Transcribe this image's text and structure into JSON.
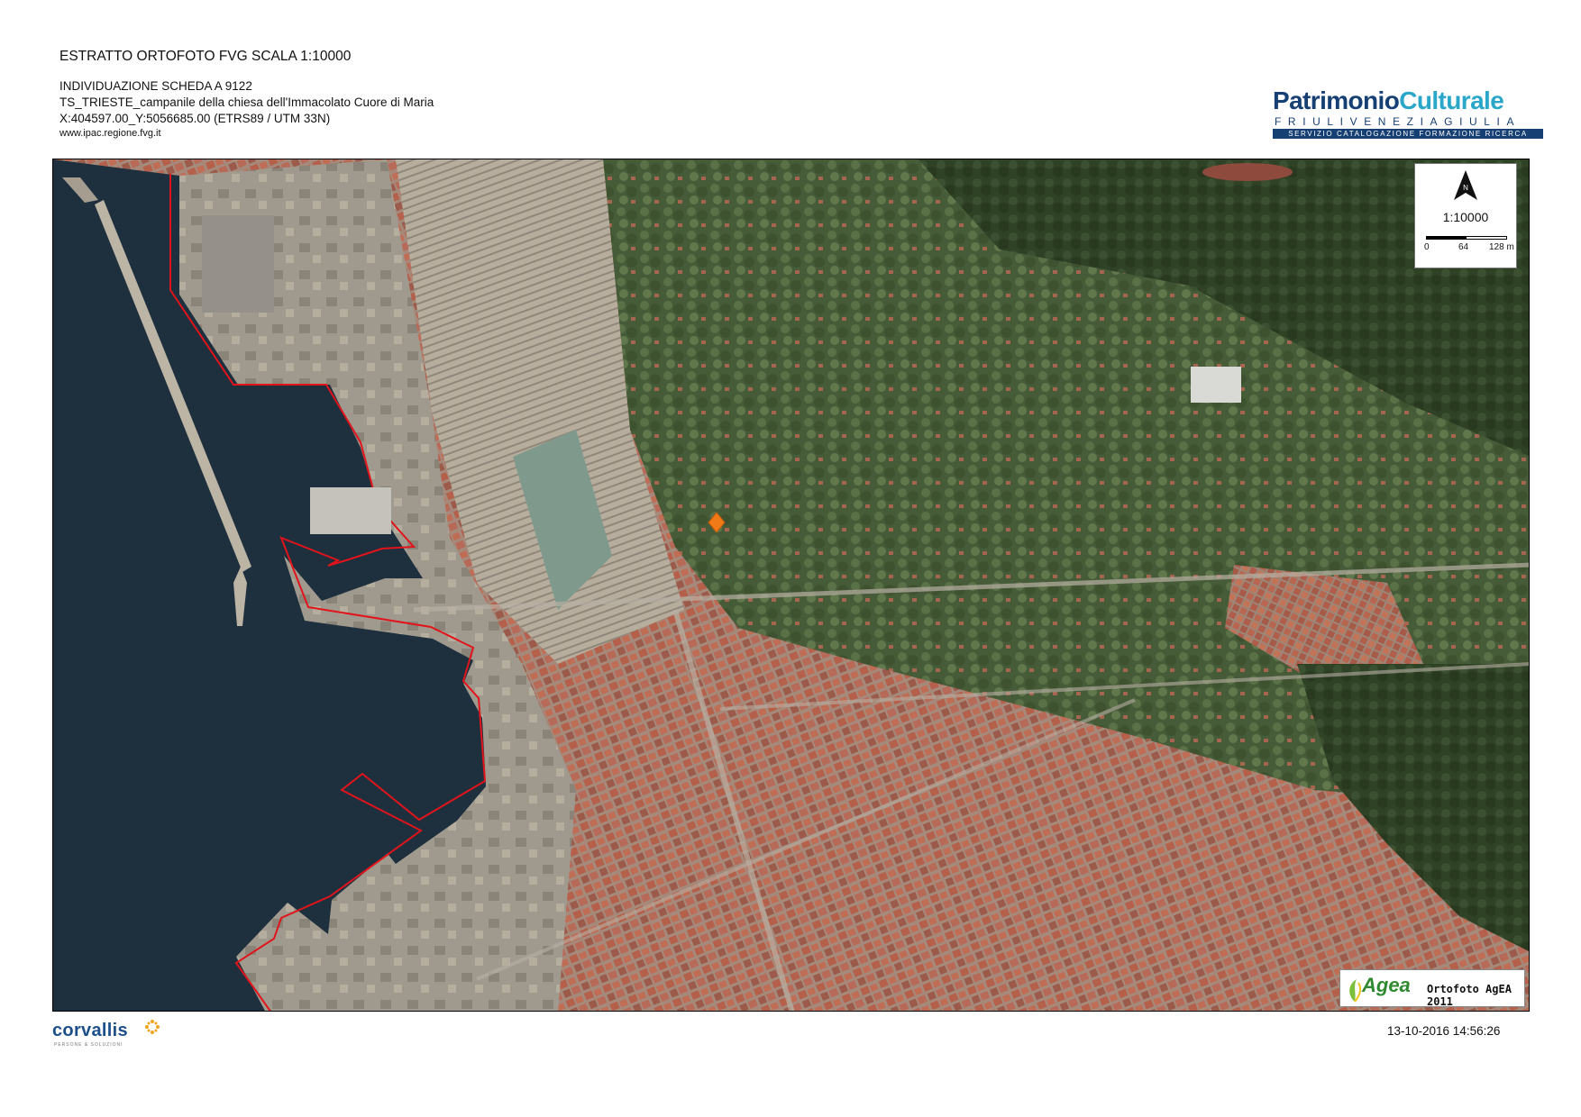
{
  "header": {
    "title": "ESTRATTO ORTOFOTO FVG SCALA 1:10000",
    "scheda": "INDIVIDUAZIONE SCHEDA A 9122",
    "subject": "TS_TRIESTE_campanile della chiesa dell'Immacolato Cuore di Maria",
    "coordinates": "X:404597.00_Y:5056685.00 (ETRS89 / UTM 33N)",
    "website": "www.ipac.regione.fvg.it"
  },
  "logo": {
    "part1": "Patrimonio",
    "part2": "Culturale",
    "region": "FRIULIVENEZIAGIULIA",
    "service": "SERVIZIO CATALOGAZIONE FORMAZIONE RICERCA"
  },
  "map": {
    "scale_label": "1:10000",
    "north_label": "N",
    "scalebar_ticks": [
      "0",
      "64",
      "128 m"
    ],
    "marker_color": "#f07a18",
    "boundary_color": "#e1141b"
  },
  "agea_badge": {
    "brand": "Agea",
    "text": "Ortofoto AgEA 2011"
  },
  "footer": {
    "company": "corvallis",
    "tagline": "PERSONE & SOLUZIONI",
    "timestamp": "13-10-2016 14:56:26"
  }
}
